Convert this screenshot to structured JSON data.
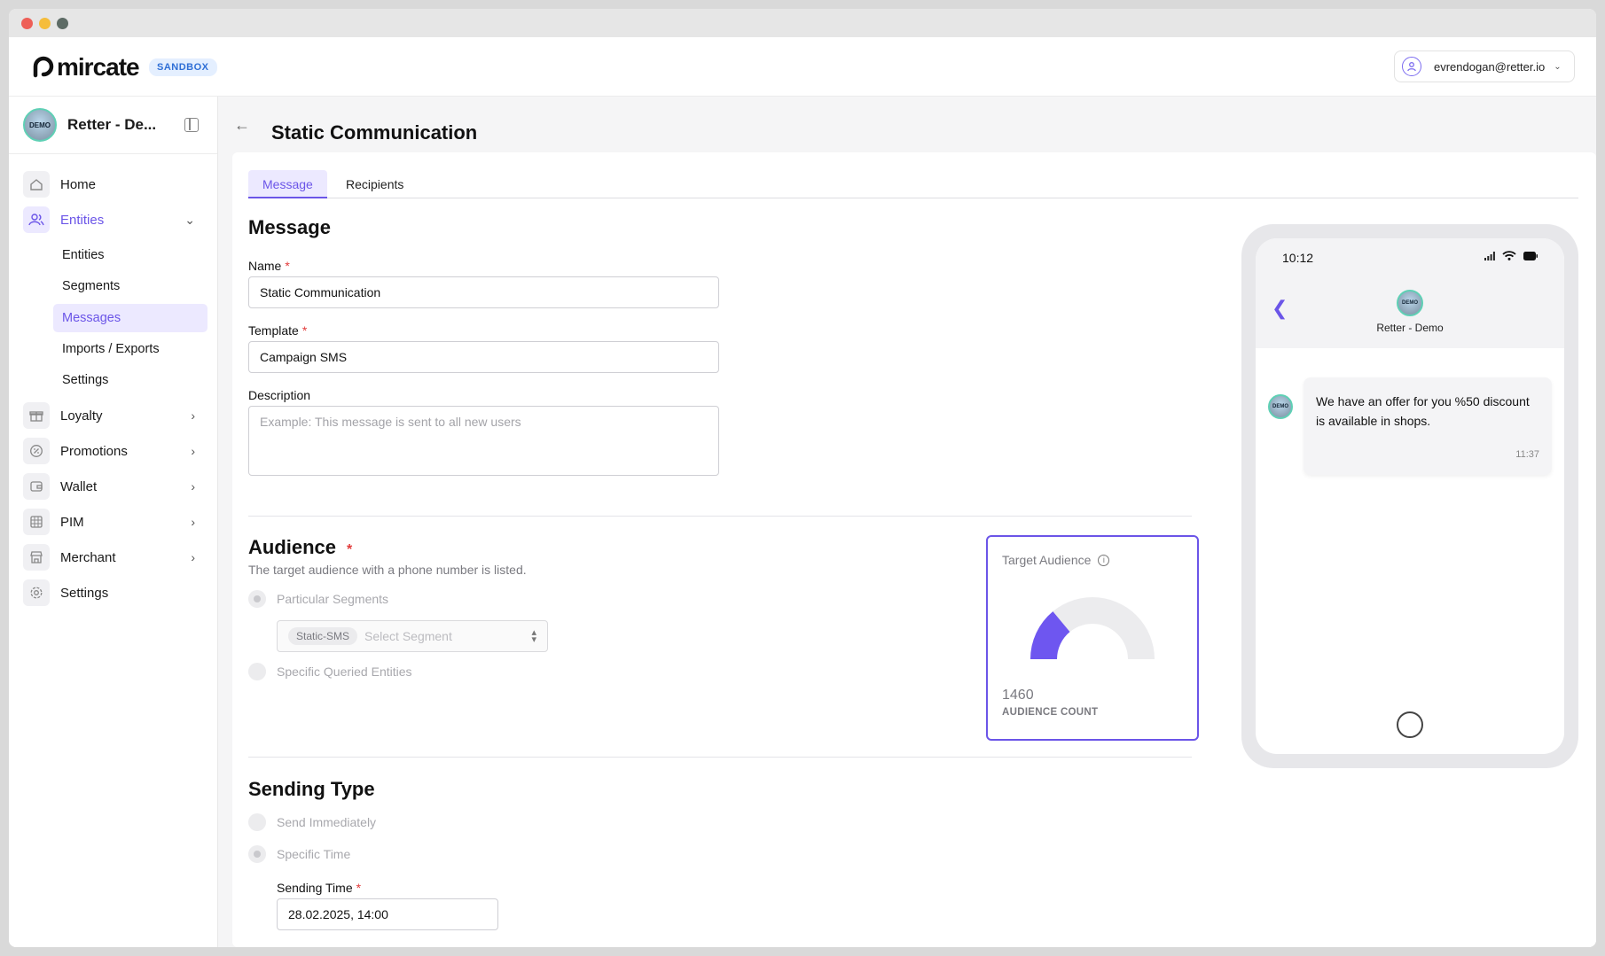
{
  "app": {
    "brand": "mircate",
    "env_badge": "SANDBOX",
    "user_email": "evrendogan@retter.io"
  },
  "sidebar": {
    "workspace_name": "Retter - De...",
    "workspace_avatar_text": "DEMO",
    "items": [
      {
        "label": "Home",
        "icon": "home-icon"
      },
      {
        "label": "Entities",
        "icon": "users-icon"
      },
      {
        "label": "Loyalty",
        "icon": "gift-icon"
      },
      {
        "label": "Promotions",
        "icon": "percent-icon"
      },
      {
        "label": "Wallet",
        "icon": "wallet-icon"
      },
      {
        "label": "PIM",
        "icon": "grid-icon"
      },
      {
        "label": "Merchant",
        "icon": "store-icon"
      },
      {
        "label": "Settings",
        "icon": "gear-icon"
      }
    ],
    "sub_items": [
      "Entities",
      "Segments",
      "Messages",
      "Imports / Exports",
      "Settings"
    ]
  },
  "page": {
    "title": "Static Communication",
    "tabs": [
      "Message",
      "Recipients"
    ]
  },
  "message_section": {
    "title": "Message",
    "name_label": "Name",
    "name_value": "Static Communication",
    "template_label": "Template",
    "template_value": "Campaign SMS",
    "description_label": "Description",
    "description_placeholder": "Example: This message is sent to all new users"
  },
  "audience": {
    "title": "Audience",
    "helper": "The target audience with a phone number is listed.",
    "option_segments": "Particular Segments",
    "segment_chip": "Static-SMS",
    "segment_placeholder": "Select Segment",
    "option_queried": "Specific Queried Entities",
    "target_title": "Target Audience",
    "audience_count": "1460",
    "audience_count_label": "AUDIENCE COUNT",
    "gauge_fraction": 0.28,
    "gauge_color": "#6e56f0",
    "gauge_track_color": "#ececee"
  },
  "sending": {
    "title": "Sending Type",
    "option_immediate": "Send Immediately",
    "option_specific": "Specific Time",
    "time_label": "Sending Time",
    "time_value": "28.02.2025, 14:00"
  },
  "phone_preview": {
    "time": "10:12",
    "sender_name": "Retter - Demo",
    "avatar_text": "DEMO",
    "message_text": "We have an offer for you %50 discount is available in shops.",
    "message_time": "11:37"
  },
  "colors": {
    "accent": "#6b55e8",
    "required": "#e23b3b"
  }
}
